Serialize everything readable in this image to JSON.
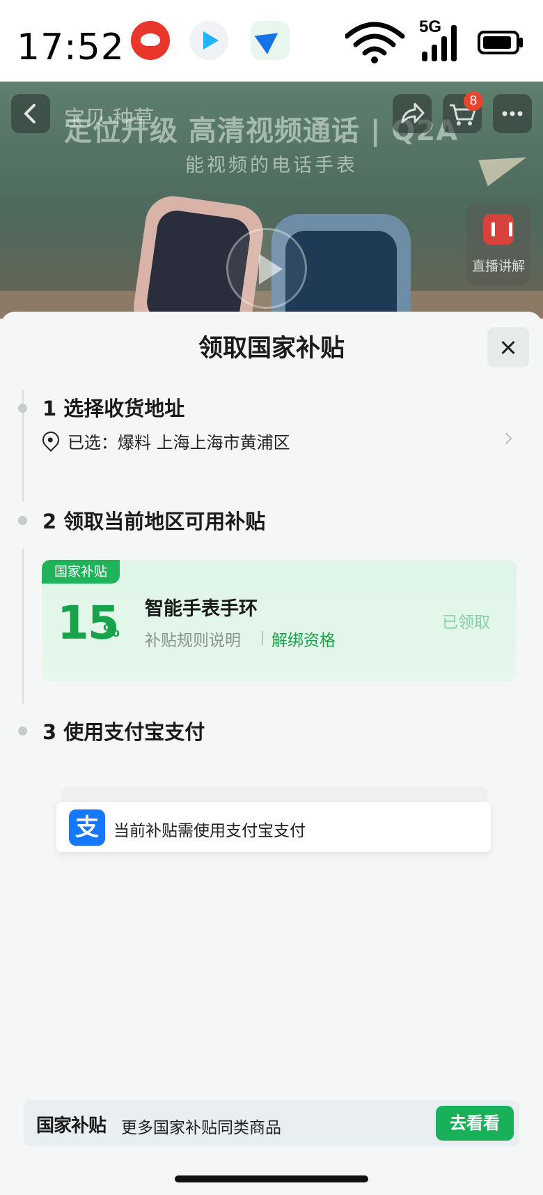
{
  "status_bar": {
    "time": "17:52",
    "network": "5G",
    "icons": [
      "cat-app-icon",
      "video-app-icon",
      "plane-app-icon",
      "wifi-icon",
      "signal-icon",
      "battery-icon"
    ]
  },
  "hero": {
    "store_name": "宝贝 种草",
    "headline": "定位升级 高清视频通话 | Q2A",
    "subline": "能视频的电话手表",
    "cart_count": "8",
    "live_label": "直播讲解"
  },
  "sheet": {
    "title": "领取国家补贴",
    "steps": [
      {
        "title": "1 选择收货地址"
      },
      {
        "title": "2 领取当前地区可用补贴"
      },
      {
        "title": "3 使用支付宝支付"
      }
    ],
    "address": {
      "prefix": "已选：",
      "value": "爆料  上海上海市黄浦区"
    },
    "subsidy_card": {
      "tag": "国家补贴",
      "percent": "15",
      "percent_unit": "%",
      "name": "智能手表手环",
      "rule_link": "补贴规则说明",
      "unbind_link": "解绑资格",
      "status": "已领取"
    },
    "payment": {
      "icon_glyph": "支",
      "text": "当前补贴需使用支付宝支付"
    }
  },
  "bottom_bar": {
    "brand": "国家补贴",
    "text": "更多国家补贴同类商品",
    "button": "去看看"
  },
  "colors": {
    "accent_green": "#16a34a",
    "button_green": "#18b15a",
    "alipay_blue": "#1677ff",
    "badge_red": "#e8452c"
  }
}
